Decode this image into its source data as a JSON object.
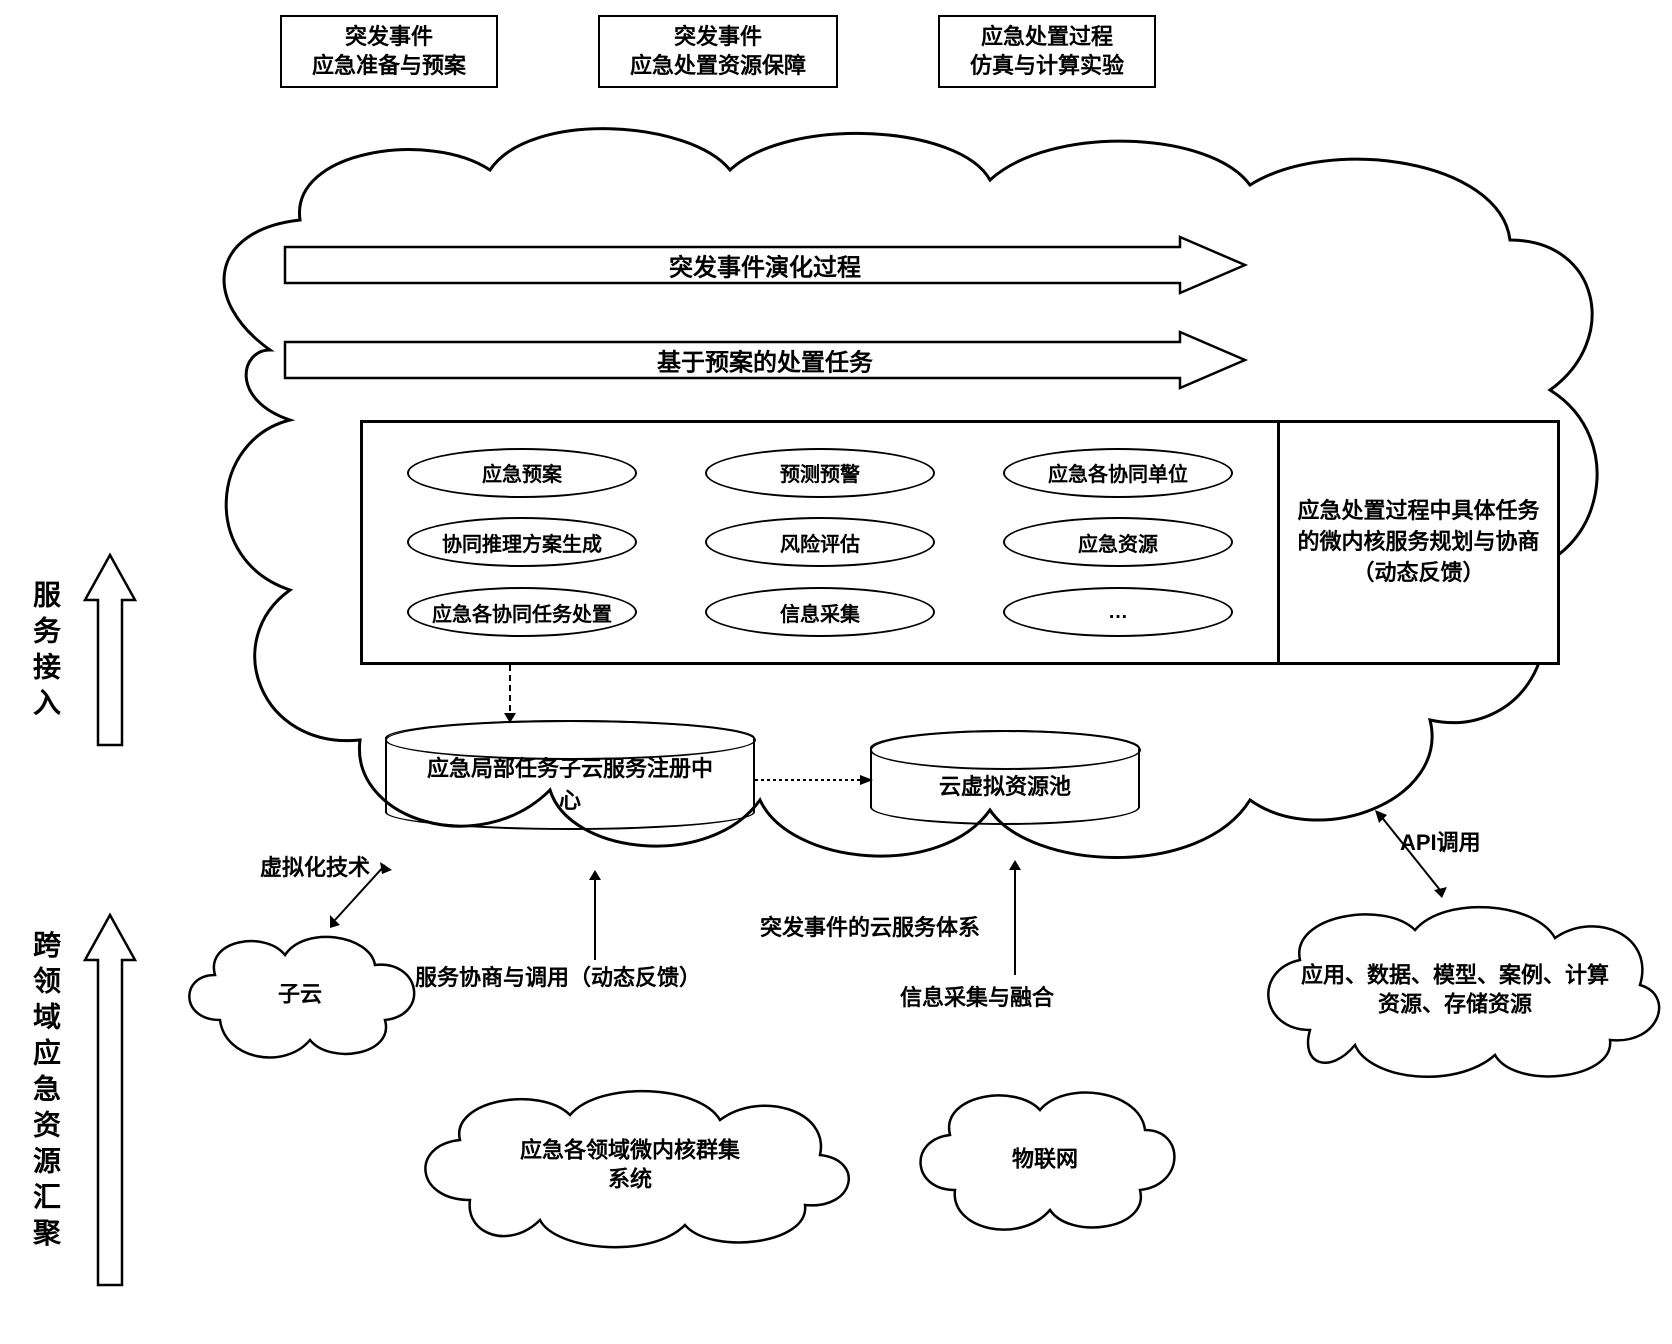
{
  "top_boxes": [
    "突发事件\n应急准备与预案",
    "突发事件\n应急处置资源保障",
    "应急处置过程\n仿真与计算实验"
  ],
  "arrows": {
    "arrow1": "突发事件演化过程",
    "arrow2": "基于预案的处置任务"
  },
  "services": {
    "s1": "应急预案",
    "s2": "预测预警",
    "s3": "应急各协同单位",
    "s4": "协同推理方案生成",
    "s5": "风险评估",
    "s6": "应急资源",
    "s7": "应急各协同任务处置",
    "s8": "信息采集",
    "s9": "…",
    "side": "应急处置过程中具体任务的微内核服务规划与协商（动态反馈）"
  },
  "cylinders": {
    "c1": "应急局部任务子云服务注册中心",
    "c2": "云虚拟资源池"
  },
  "clouds": {
    "subcloud": "子云",
    "microkernel": "应急各领域微内核群集系统",
    "iot": "物联网",
    "resource": "应用、数据、模型、案例、计算资源、存储资源"
  },
  "labels": {
    "virt": "虚拟化技术",
    "negotiate": "服务协商与调用（动态反馈）",
    "cloud_system": "突发事件的云服务体系",
    "info_collect": "信息采集与融合",
    "api": "API调用"
  },
  "left": {
    "service_access": "服务接入",
    "cross_domain": "跨领域应急资源汇聚"
  }
}
